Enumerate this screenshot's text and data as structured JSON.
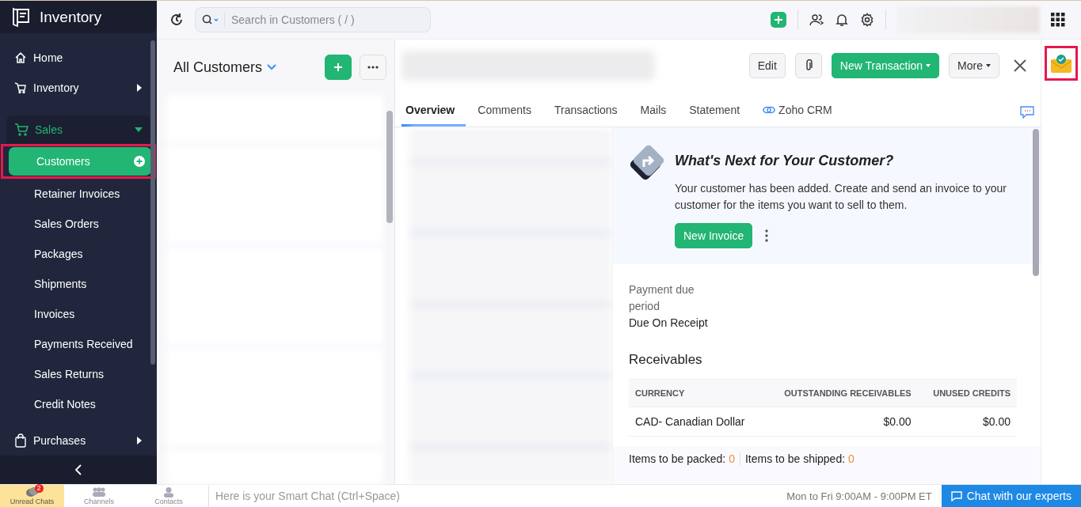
{
  "app": {
    "title": "Inventory"
  },
  "topbar": {
    "search_placeholder": "Search in Customers ( / )"
  },
  "sidebar": {
    "home": {
      "label": "Home"
    },
    "inventory": {
      "label": "Inventory",
      "expanded": false
    },
    "sales": {
      "label": "Sales",
      "expanded": true,
      "items": [
        {
          "label": "Customers",
          "selected": true
        },
        {
          "label": "Retainer Invoices",
          "selected": false
        },
        {
          "label": "Sales Orders",
          "selected": false
        },
        {
          "label": "Packages",
          "selected": false
        },
        {
          "label": "Shipments",
          "selected": false
        },
        {
          "label": "Invoices",
          "selected": false
        },
        {
          "label": "Payments Received",
          "selected": false
        },
        {
          "label": "Sales Returns",
          "selected": false
        },
        {
          "label": "Credit Notes",
          "selected": false
        }
      ]
    },
    "purchases": {
      "label": "Purchases",
      "expanded": false
    }
  },
  "list": {
    "title": "All Customers"
  },
  "detail": {
    "buttons": {
      "edit": "Edit",
      "new_transaction": "New Transaction",
      "more": "More"
    },
    "tabs": [
      {
        "label": "Overview",
        "selected": true,
        "kind": "text"
      },
      {
        "label": "Comments",
        "selected": false,
        "kind": "text"
      },
      {
        "label": "Transactions",
        "selected": false,
        "kind": "text"
      },
      {
        "label": "Mails",
        "selected": false,
        "kind": "text"
      },
      {
        "label": "Statement",
        "selected": false,
        "kind": "text"
      },
      {
        "label": "Zoho CRM",
        "selected": false,
        "kind": "crm"
      }
    ],
    "next_card": {
      "title": "What's Next for Your Customer?",
      "text": "Your customer has been added. Create and send an invoice to your customer for the items you want to sell to them.",
      "button": "New Invoice"
    },
    "payment_due": {
      "label": "Payment due period",
      "value": "Due On Receipt"
    },
    "receivables": {
      "title": "Receivables",
      "columns": [
        "CURRENCY",
        "OUTSTANDING RECEIVABLES",
        "UNUSED CREDITS"
      ],
      "rows": [
        [
          "CAD- Canadian Dollar",
          "$0.00",
          "$0.00"
        ]
      ]
    },
    "counts": [
      {
        "label": "Items to be packed:",
        "value": "0"
      },
      {
        "label": "Items to be shipped:",
        "value": "0"
      }
    ]
  },
  "bottom_bar": {
    "tabs": [
      {
        "label": "Unread Chats",
        "selected": true,
        "badge": "2",
        "kind": "chats"
      },
      {
        "label": "Channels",
        "selected": false,
        "kind": "channels"
      },
      {
        "label": "Contacts",
        "selected": false,
        "kind": "contacts"
      }
    ],
    "chat_placeholder": "Here is your Smart Chat (Ctrl+Space)",
    "hours": "Mon to Fri 9:00AM - 9:00PM ET",
    "chat_button": "Chat with our experts"
  }
}
